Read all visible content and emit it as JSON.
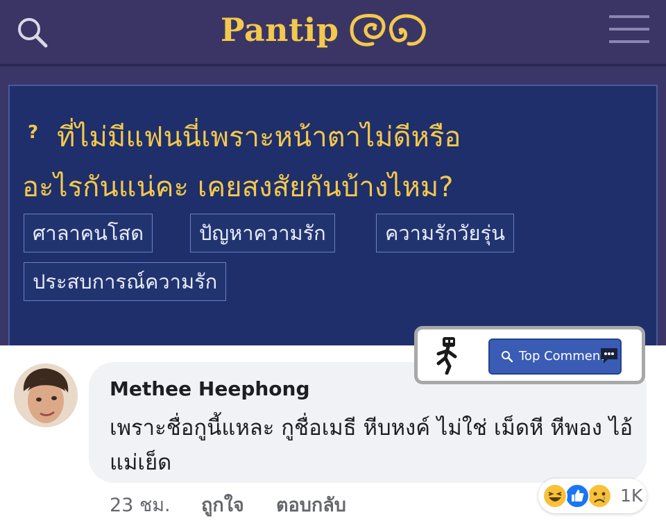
{
  "header": {
    "logo_text": "Pantip",
    "logo_mark_icon": "pantip-eyes-logo",
    "search_icon": "search-icon",
    "menu_icon": "hamburger-menu-icon",
    "colors": {
      "bar": "#3b3566",
      "logo": "#f2c94c"
    }
  },
  "topic": {
    "icon": "question-mark-icon",
    "title_line1": "ที่ไม่มีแฟนนี่เพราะหน้าตาไม่ดีหรือ",
    "title_line2": "อะไรกันแน่คะ เคยสงสัยกันบ้างไหม?",
    "tags": [
      "ศาลาคนโสด",
      "ปัญหาความรัก",
      "ความรักวัยรุ่น",
      "ประสบการณ์ความรัก"
    ],
    "colors": {
      "card": "#1f2f6b",
      "title": "#f2c94c"
    }
  },
  "top_comment_badge": {
    "label": "Top Comment",
    "runner_icon": "running-person-icon",
    "search_icon": "search-icon",
    "chat_icon": "chat-bubble-icon"
  },
  "comment": {
    "author": "Methee Heephong",
    "text": "เพราะชื่อกูนี้แหละ กูชื่อเมธี หีบหงค์ ไม่ใช่ เม็ดหี หีพอง ไอ้แม่เย็ด",
    "time": "23 ชม.",
    "like_label": "ถูกใจ",
    "reply_label": "ตอบกลับ",
    "reactions": [
      "haha-icon",
      "like-icon",
      "sad-icon"
    ],
    "reaction_count": "1K"
  }
}
